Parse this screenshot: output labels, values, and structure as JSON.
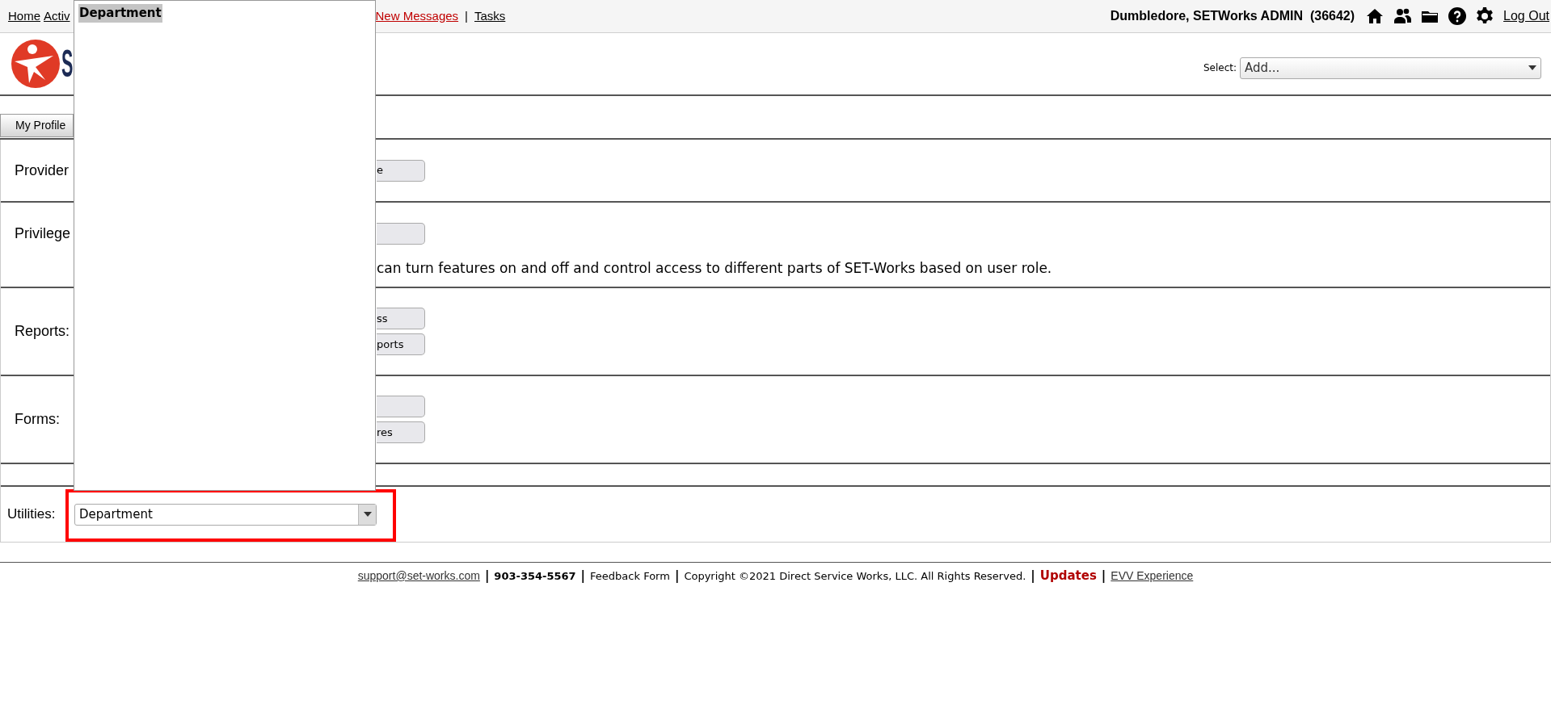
{
  "top_nav": {
    "links": [
      {
        "label": "Home",
        "kind": "plain"
      },
      {
        "label": "Activ",
        "kind": "plain"
      },
      {
        "label": "New Messages",
        "kind": "alert"
      },
      {
        "label": "|",
        "kind": "sep"
      },
      {
        "label": "Tasks",
        "kind": "plain"
      }
    ],
    "user": "Dumbledore, SETWorks ADMIN  (36642)",
    "logout": "Log Out"
  },
  "logo": {
    "text": "S"
  },
  "add_select": {
    "label": "Select:",
    "value": "Add..."
  },
  "tabs": [
    {
      "label": "My Profile",
      "selected": false
    }
  ],
  "sections": [
    {
      "label": "Provider",
      "buttons": [
        {
          "kind": "button",
          "label": "e"
        }
      ]
    },
    {
      "label": "Privilege",
      "buttons": [
        {
          "kind": "button"
        }
      ],
      "description": "can turn features on and off and control access to different parts of SET-Works based on user role."
    },
    {
      "label": "Reports:",
      "buttons": [
        {
          "kind": "button",
          "label": "ss"
        },
        {
          "kind": "button",
          "label": "ports"
        }
      ]
    },
    {
      "label": "Forms:",
      "buttons": [
        {
          "kind": "button"
        },
        {
          "kind": "button",
          "label": "res"
        }
      ]
    },
    {
      "kind": "spacer"
    }
  ],
  "utilities": {
    "label": "Utilities:",
    "value": "Department",
    "highlighted": true,
    "open_list": [
      {
        "label": "Department",
        "selected": true
      }
    ]
  },
  "footer": [
    {
      "kind": "link",
      "text": "support@set-works.com"
    },
    {
      "kind": "sep",
      "text": "|"
    },
    {
      "kind": "bold",
      "text": "903-354-5567"
    },
    {
      "kind": "sep",
      "text": "|"
    },
    {
      "kind": "plain",
      "text": "Feedback Form"
    },
    {
      "kind": "sep",
      "text": "|"
    },
    {
      "kind": "plain",
      "text": "Copyright ©2021 Direct Service Works, LLC. All Rights Reserved."
    },
    {
      "kind": "sep",
      "text": "|"
    },
    {
      "kind": "alert",
      "text": "Updates"
    },
    {
      "kind": "sep",
      "text": "|"
    },
    {
      "kind": "link",
      "text": "EVV Experience"
    }
  ]
}
